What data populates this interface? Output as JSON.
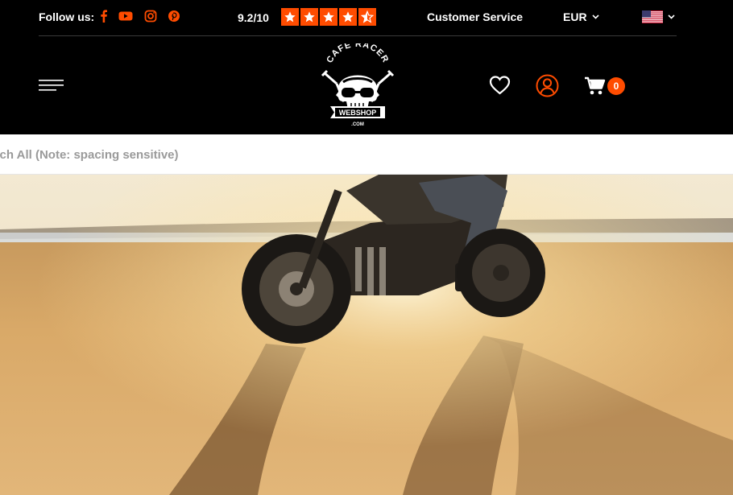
{
  "topbar": {
    "follow_label": "Follow us:",
    "social_icons": [
      "facebook-icon",
      "youtube-icon",
      "instagram-icon",
      "pinterest-icon"
    ],
    "rating": "9.2/10",
    "customer_service": "Customer Service",
    "currency": "EUR",
    "language_flag": "us-flag-icon"
  },
  "header": {
    "logo": {
      "top_text": "CAFE RACER",
      "banner_text": "WEBSHOP",
      "bottom_text": ".COM"
    },
    "cart_count": "0"
  },
  "search": {
    "placeholder": "Search All (Note: spacing sensitive)"
  },
  "colors": {
    "accent": "#ff4c00",
    "header_bg": "#000000",
    "search_text": "#9a9a9a"
  }
}
